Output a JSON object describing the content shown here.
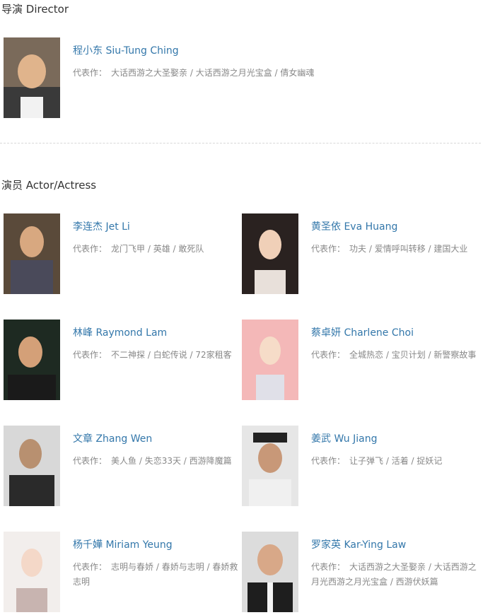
{
  "sections": {
    "director_title": "导演 Director",
    "cast_title": "演员 Actor/Actress"
  },
  "works_label": "代表作：",
  "director": {
    "name": "程小东 Siu-Tung Ching",
    "works": "大话西游之大圣娶亲 / 大话西游之月光宝盒 / 倩女幽魂"
  },
  "cast": [
    {
      "name": "李连杰 Jet Li",
      "works": "龙门飞甲 / 英雄 / 敢死队"
    },
    {
      "name": "黄圣依 Eva Huang",
      "works": "功夫 / 爱情呼叫转移 / 建国大业"
    },
    {
      "name": "林峰 Raymond Lam",
      "works": "不二神探 / 白蛇传说 / 72家租客"
    },
    {
      "name": "蔡卓妍 Charlene Choi",
      "works": "全城热恋 / 宝贝计划 / 新警察故事"
    },
    {
      "name": "文章 Zhang Wen",
      "works": "美人鱼 / 失恋33天 / 西游降魔篇"
    },
    {
      "name": "姜武 Wu Jiang",
      "works": "让子弹飞 / 活着 / 捉妖记"
    },
    {
      "name": "杨千嬅 Miriam Yeung",
      "works": "志明与春娇 / 春娇与志明 / 春娇救志明"
    },
    {
      "name": "罗家英 Kar-Ying Law",
      "works": "大话西游之大圣娶亲 / 大话西游之月光西游之月光宝盒 / 西游伏妖篇"
    }
  ],
  "colors": {
    "link": "#3377aa",
    "muted": "#888888",
    "title": "#333333"
  }
}
